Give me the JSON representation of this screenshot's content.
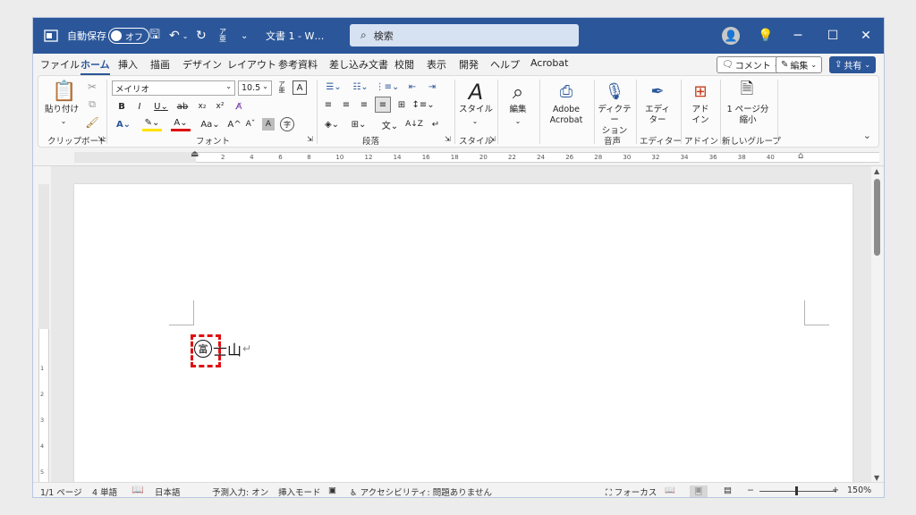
{
  "title_bar": {
    "autosave_label": "自動保存",
    "autosave_state": "オフ",
    "doc_title": "文書 1 - W…",
    "search_placeholder": "検索",
    "accent_color": "#2b579a"
  },
  "tabs": [
    "ファイル",
    "ホーム",
    "挿入",
    "描画",
    "デザイン",
    "レイアウト",
    "参考資料",
    "差し込み文書",
    "校閲",
    "表示",
    "開発",
    "ヘルプ",
    "Acrobat"
  ],
  "active_tab": "ホーム",
  "tab_buttons": {
    "comment": "コメント",
    "edit": "編集",
    "share": "共有"
  },
  "ribbon": {
    "clipboard": {
      "paste": "貼り付け",
      "label": "クリップボード"
    },
    "font": {
      "font_name": "メイリオ",
      "font_size": "10.5",
      "label": "フォント"
    },
    "paragraph": {
      "label": "段落"
    },
    "styles": {
      "button": "スタイル",
      "label": "スタイル"
    },
    "editing": {
      "button": "編集"
    },
    "acrobat": {
      "line1": "Adobe",
      "line2": "Acrobat"
    },
    "voice": {
      "line1": "ディクテー",
      "line2": "ション",
      "label": "音声"
    },
    "editor": {
      "line1": "エディ",
      "line2": "ター",
      "label": "エディター"
    },
    "addins": {
      "line1": "アド",
      "line2": "イン",
      "label": "アドイン"
    },
    "newgroup": {
      "line1": "1 ページ分",
      "line2": "縮小",
      "label": "新しいグループ"
    }
  },
  "ruler": {
    "h_ticks": [
      "2",
      "4",
      "6",
      "8",
      "10",
      "12",
      "14",
      "16",
      "18",
      "20",
      "22",
      "24",
      "26",
      "28",
      "30",
      "32",
      "34",
      "36",
      "38",
      "40"
    ],
    "v_ticks": [
      "1",
      "2",
      "3",
      "4",
      "5"
    ]
  },
  "document": {
    "enclosed_char": "富",
    "rest_text": "士山",
    "para_mark": "↵"
  },
  "status": {
    "page": "1/1 ページ",
    "words": "4 単語",
    "language": "日本語",
    "predictive": "予測入力: オン",
    "insert_mode": "挿入モード",
    "accessibility": "アクセシビリティ: 問題ありません",
    "focus": "フォーカス",
    "zoom": "150%"
  }
}
